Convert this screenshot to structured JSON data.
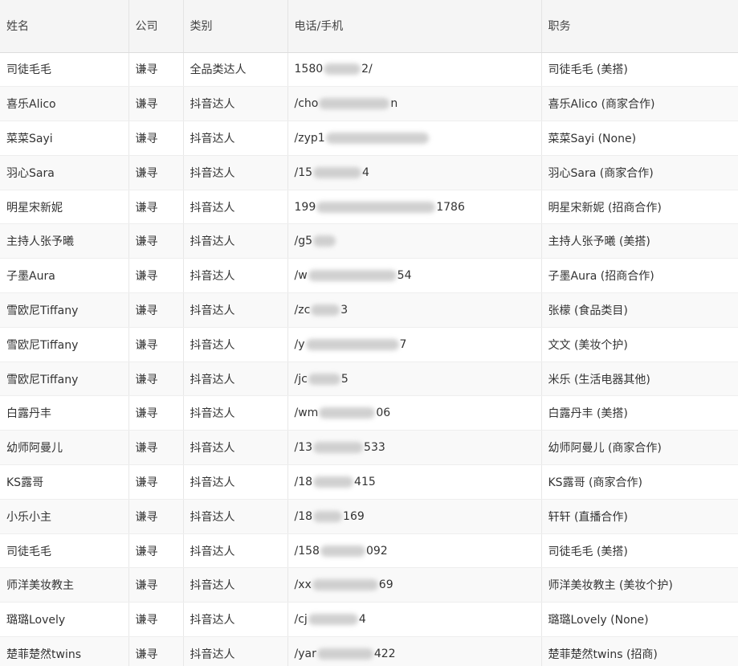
{
  "table": {
    "headers": [
      "姓名",
      "公司",
      "类别",
      "电话/手机",
      "职务"
    ],
    "rows": [
      {
        "name": "司徒毛毛",
        "company": "谦寻",
        "type": "全品类达人",
        "phone_prefix": "1580",
        "phone_suffix": "2/",
        "role": "司徒毛毛 (美搭)"
      },
      {
        "name": "喜乐Alico",
        "company": "谦寻",
        "type": "抖音达人",
        "phone_prefix": "/cho",
        "phone_suffix": "n",
        "role": "喜乐Alico (商家合作)"
      },
      {
        "name": "菜菜Sayi",
        "company": "谦寻",
        "type": "抖音达人",
        "phone_prefix": "/zyp1",
        "phone_suffix": "",
        "role": "菜菜Sayi (None)"
      },
      {
        "name": "羽心Sara",
        "company": "谦寻",
        "type": "抖音达人",
        "phone_prefix": "/15",
        "phone_suffix": "4",
        "role": "羽心Sara (商家合作)"
      },
      {
        "name": "明星宋新妮",
        "company": "谦寻",
        "type": "抖音达人",
        "phone_prefix": "199",
        "phone_suffix": "1786",
        "role": "明星宋新妮 (招商合作)"
      },
      {
        "name": "主持人张予曦",
        "company": "谦寻",
        "type": "抖音达人",
        "phone_prefix": "/g5",
        "phone_suffix": "",
        "role": "主持人张予曦 (美搭)"
      },
      {
        "name": "子墨Aura",
        "company": "谦寻",
        "type": "抖音达人",
        "phone_prefix": "/w",
        "phone_suffix": "54",
        "role": "子墨Aura (招商合作)"
      },
      {
        "name": "雪欧尼Tiffany",
        "company": "谦寻",
        "type": "抖音达人",
        "phone_prefix": "/zc",
        "phone_suffix": "3",
        "role": "张檬 (食品类目)"
      },
      {
        "name": "雪欧尼Tiffany",
        "company": "谦寻",
        "type": "抖音达人",
        "phone_prefix": "/y",
        "phone_suffix": "7",
        "role": "文文 (美妆个护)"
      },
      {
        "name": "雪欧尼Tiffany",
        "company": "谦寻",
        "type": "抖音达人",
        "phone_prefix": "/jc",
        "phone_suffix": "5",
        "role": "米乐 (生活电器其他)"
      },
      {
        "name": "白露丹丰",
        "company": "谦寻",
        "type": "抖音达人",
        "phone_prefix": "/wm",
        "phone_suffix": "06",
        "role": "白露丹丰 (美搭)"
      },
      {
        "name": "幼师阿曼儿",
        "company": "谦寻",
        "type": "抖音达人",
        "phone_prefix": "/13",
        "phone_suffix": "533",
        "role": "幼师阿曼儿 (商家合作)"
      },
      {
        "name": "KS露哥",
        "company": "谦寻",
        "type": "抖音达人",
        "phone_prefix": "/18",
        "phone_suffix": "415",
        "role": "KS露哥 (商家合作)"
      },
      {
        "name": "小乐小主",
        "company": "谦寻",
        "type": "抖音达人",
        "phone_prefix": "/18",
        "phone_suffix": "169",
        "role": "轩轩 (直播合作)"
      },
      {
        "name": "司徒毛毛",
        "company": "谦寻",
        "type": "抖音达人",
        "phone_prefix": "/158",
        "phone_suffix": "092",
        "role": "司徒毛毛 (美搭)"
      },
      {
        "name": "师洋美妆教主",
        "company": "谦寻",
        "type": "抖音达人",
        "phone_prefix": "/xx",
        "phone_suffix": "69",
        "role": "师洋美妆教主 (美妆个护)"
      },
      {
        "name": "璐璐Lovely",
        "company": "谦寻",
        "type": "抖音达人",
        "phone_prefix": "/cj",
        "phone_suffix": "4",
        "role": "璐璐Lovely (None)"
      },
      {
        "name": "楚菲楚然twins",
        "company": "谦寻",
        "type": "抖音达人",
        "phone_prefix": "/yar",
        "phone_suffix": "422",
        "role": "楚菲楚然twins (招商)"
      }
    ]
  }
}
